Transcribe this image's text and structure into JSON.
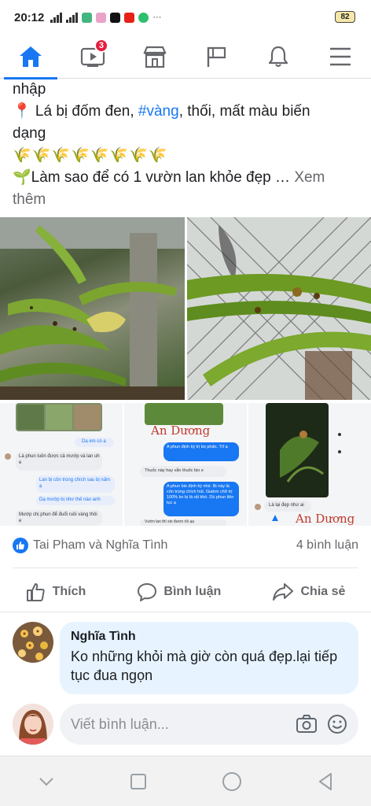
{
  "status_bar": {
    "time": "20:12",
    "battery": "82"
  },
  "nav": {
    "items": [
      {
        "name": "home",
        "icon": "home-icon",
        "active": true
      },
      {
        "name": "watch",
        "icon": "video-icon",
        "badge": "3"
      },
      {
        "name": "marketplace",
        "icon": "store-icon"
      },
      {
        "name": "pages",
        "icon": "flag-icon"
      },
      {
        "name": "notifications",
        "icon": "bell-icon"
      },
      {
        "name": "menu",
        "icon": "hamburger-icon"
      }
    ],
    "accent": "#1877f2"
  },
  "post": {
    "line1": "nhập",
    "line2_prefix": "📍 Lá bị đốm đen, ",
    "line2_hashtag": "#vàng",
    "line2_suffix": ",  thối,  mất màu biến",
    "line3": "dạng",
    "line4": "🌾🌾🌾🌾🌾🌾🌾🌾",
    "line5": "🌱Làm sao để có 1 vườn lan khỏe đẹp … ",
    "see_more_1": "Xem",
    "see_more_2": "thêm"
  },
  "screenshots": {
    "s1": {
      "msg1": "Dạ em có ạ",
      "msg2": "Là phun luôn được cả mướp và lan uh e",
      "msg3": "Lan bị côn trùng chích sau bị nấm ạ",
      "msg4": "Dạ mướp bị như thế nào anh",
      "msg5": "Mướp chị phun để đuổi ruồi vàng thôi e"
    },
    "s2": {
      "watermark": "An Dương",
      "msg1": "A phun định kỳ trị bọ phấn. Trĩ ạ",
      "msg2": "Thuốc này hay vẫn thuốc bio e",
      "msg3": "A phun bio định kỳ nhé. Bị này là côn trùng chích hút. Giatrm chữ trị 100% ko bị lá rất khó. Dù phun liên tục ạ",
      "msg4": "Vườn lan thì xịn đươn rồi ạa"
    },
    "s3": {
      "msg1": "Lá lại đẹp như ai",
      "watermark": "An Dương"
    }
  },
  "reactions": {
    "names": "Tai Pham và Nghĩa Tình",
    "comments_count": "4 bình luận"
  },
  "actions": {
    "like": "Thích",
    "comment": "Bình luận",
    "share": "Chia sẻ"
  },
  "comment": {
    "author": "Nghĩa Tình",
    "text": "Ko những khỏi mà giờ còn quá đẹp.lại tiếp tục đua ngọn"
  },
  "write_comment": {
    "placeholder": "Viết bình luận..."
  }
}
